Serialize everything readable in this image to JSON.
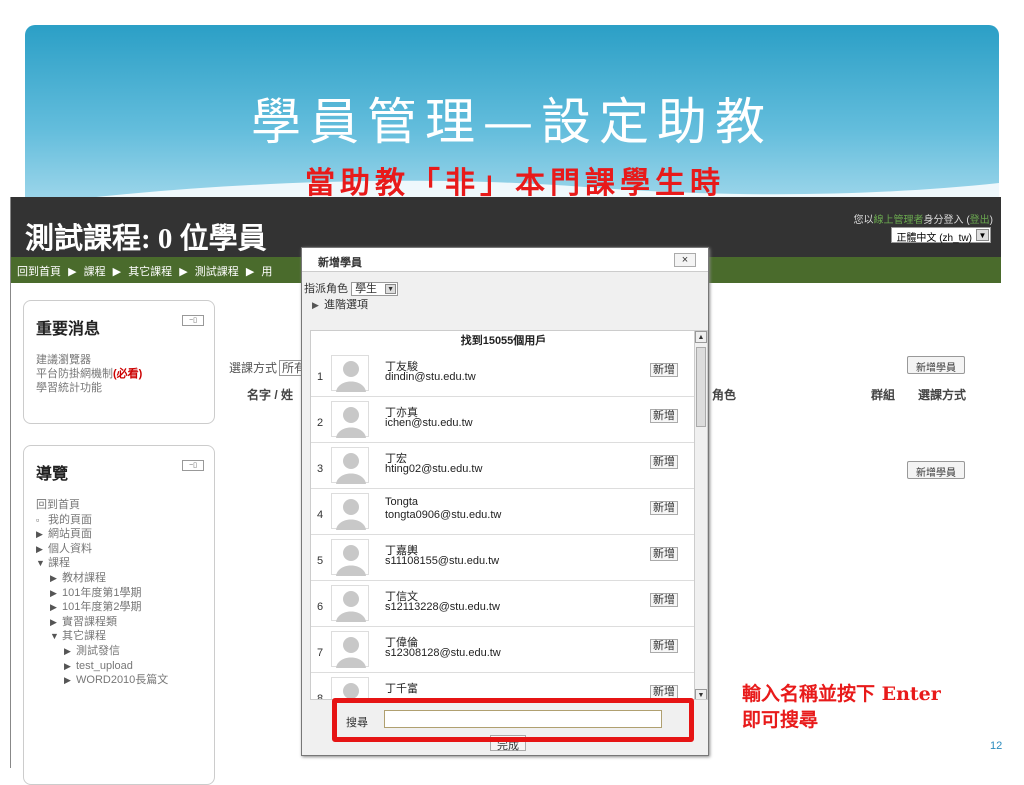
{
  "slide": {
    "title": "學員管理—設定助教",
    "subtitle": "當助教「非」本門課學生時",
    "annotation_line1": "輸入名稱並按下 Enter",
    "annotation_line2": "即可搜尋",
    "page_number": "12",
    "colors": {
      "banner": "#2b9fc6",
      "accent_red": "#e81a1a"
    }
  },
  "header": {
    "course_title": "測試課程: 0 位學員",
    "login_prefix": "您以",
    "login_role": "線上管理者",
    "login_suffix": "身分登入 (",
    "logout": "登出",
    "login_close": ")",
    "language": "正體中文 (zh_tw)"
  },
  "breadcrumb": [
    "回到首頁",
    "課程",
    "其它課程",
    "測試課程",
    "用"
  ],
  "breadcrumb_sep": "▶",
  "news_block": {
    "title": "重要消息",
    "items": [
      "建議瀏覽器",
      "平台防掛網機制",
      "學習統計功能"
    ],
    "required_tag": "(必看)"
  },
  "nav_block": {
    "title": "導覽",
    "items": [
      {
        "label": "回到首頁",
        "marker": "",
        "level": 1
      },
      {
        "label": "我的頁面",
        "marker": "▫",
        "level": 1
      },
      {
        "label": "網站頁面",
        "marker": "▶",
        "level": 1
      },
      {
        "label": "個人資料",
        "marker": "▶",
        "level": 1
      },
      {
        "label": "課程",
        "marker": "▼",
        "level": 1
      },
      {
        "label": "教材課程",
        "marker": "▶",
        "level": 2
      },
      {
        "label": "101年度第1學期",
        "marker": "▶",
        "level": 2
      },
      {
        "label": "101年度第2學期",
        "marker": "▶",
        "level": 2
      },
      {
        "label": "實習課程類",
        "marker": "▶",
        "level": 2
      },
      {
        "label": "其它課程",
        "marker": "▼",
        "level": 2
      },
      {
        "label": "測試發信",
        "marker": "▶",
        "level": 3
      },
      {
        "label": "test_upload",
        "marker": "▶",
        "level": 3
      },
      {
        "label": "WORD2010長篇文",
        "marker": "▶",
        "level": 3
      }
    ]
  },
  "main": {
    "enrol_method_label": "選課方式",
    "enrol_method_value": "所有",
    "name_col": "名字 / 姓",
    "role_col": "角色",
    "group_col": "群組",
    "enrol_col": "選課方式",
    "add_students_btn": "新增學員"
  },
  "dialog": {
    "title": "新增學員",
    "close": "×",
    "assign_role_label": "指派角色",
    "assign_role_value": "學生",
    "advanced": "進階選項",
    "found_text": "找到15055個用戶",
    "add_label": "新增",
    "search_label": "搜尋",
    "search_value": "",
    "done_label": "完成",
    "users": [
      {
        "num": "1",
        "name": "丁友駿",
        "email": "dindin@stu.edu.tw"
      },
      {
        "num": "2",
        "name": "丁亦真",
        "email": "ichen@stu.edu.tw"
      },
      {
        "num": "3",
        "name": "丁宏",
        "email": "hting02@stu.edu.tw"
      },
      {
        "num": "4",
        "name": "Tongta",
        "email": "tongta0906@stu.edu.tw"
      },
      {
        "num": "5",
        "name": "丁嘉輿",
        "email": "s11108155@stu.edu.tw"
      },
      {
        "num": "6",
        "name": "丁信文",
        "email": "s12113228@stu.edu.tw"
      },
      {
        "num": "7",
        "name": "丁偉倫",
        "email": "s12308128@stu.edu.tw"
      },
      {
        "num": "8",
        "name": "丁千富",
        "email": ""
      }
    ]
  }
}
